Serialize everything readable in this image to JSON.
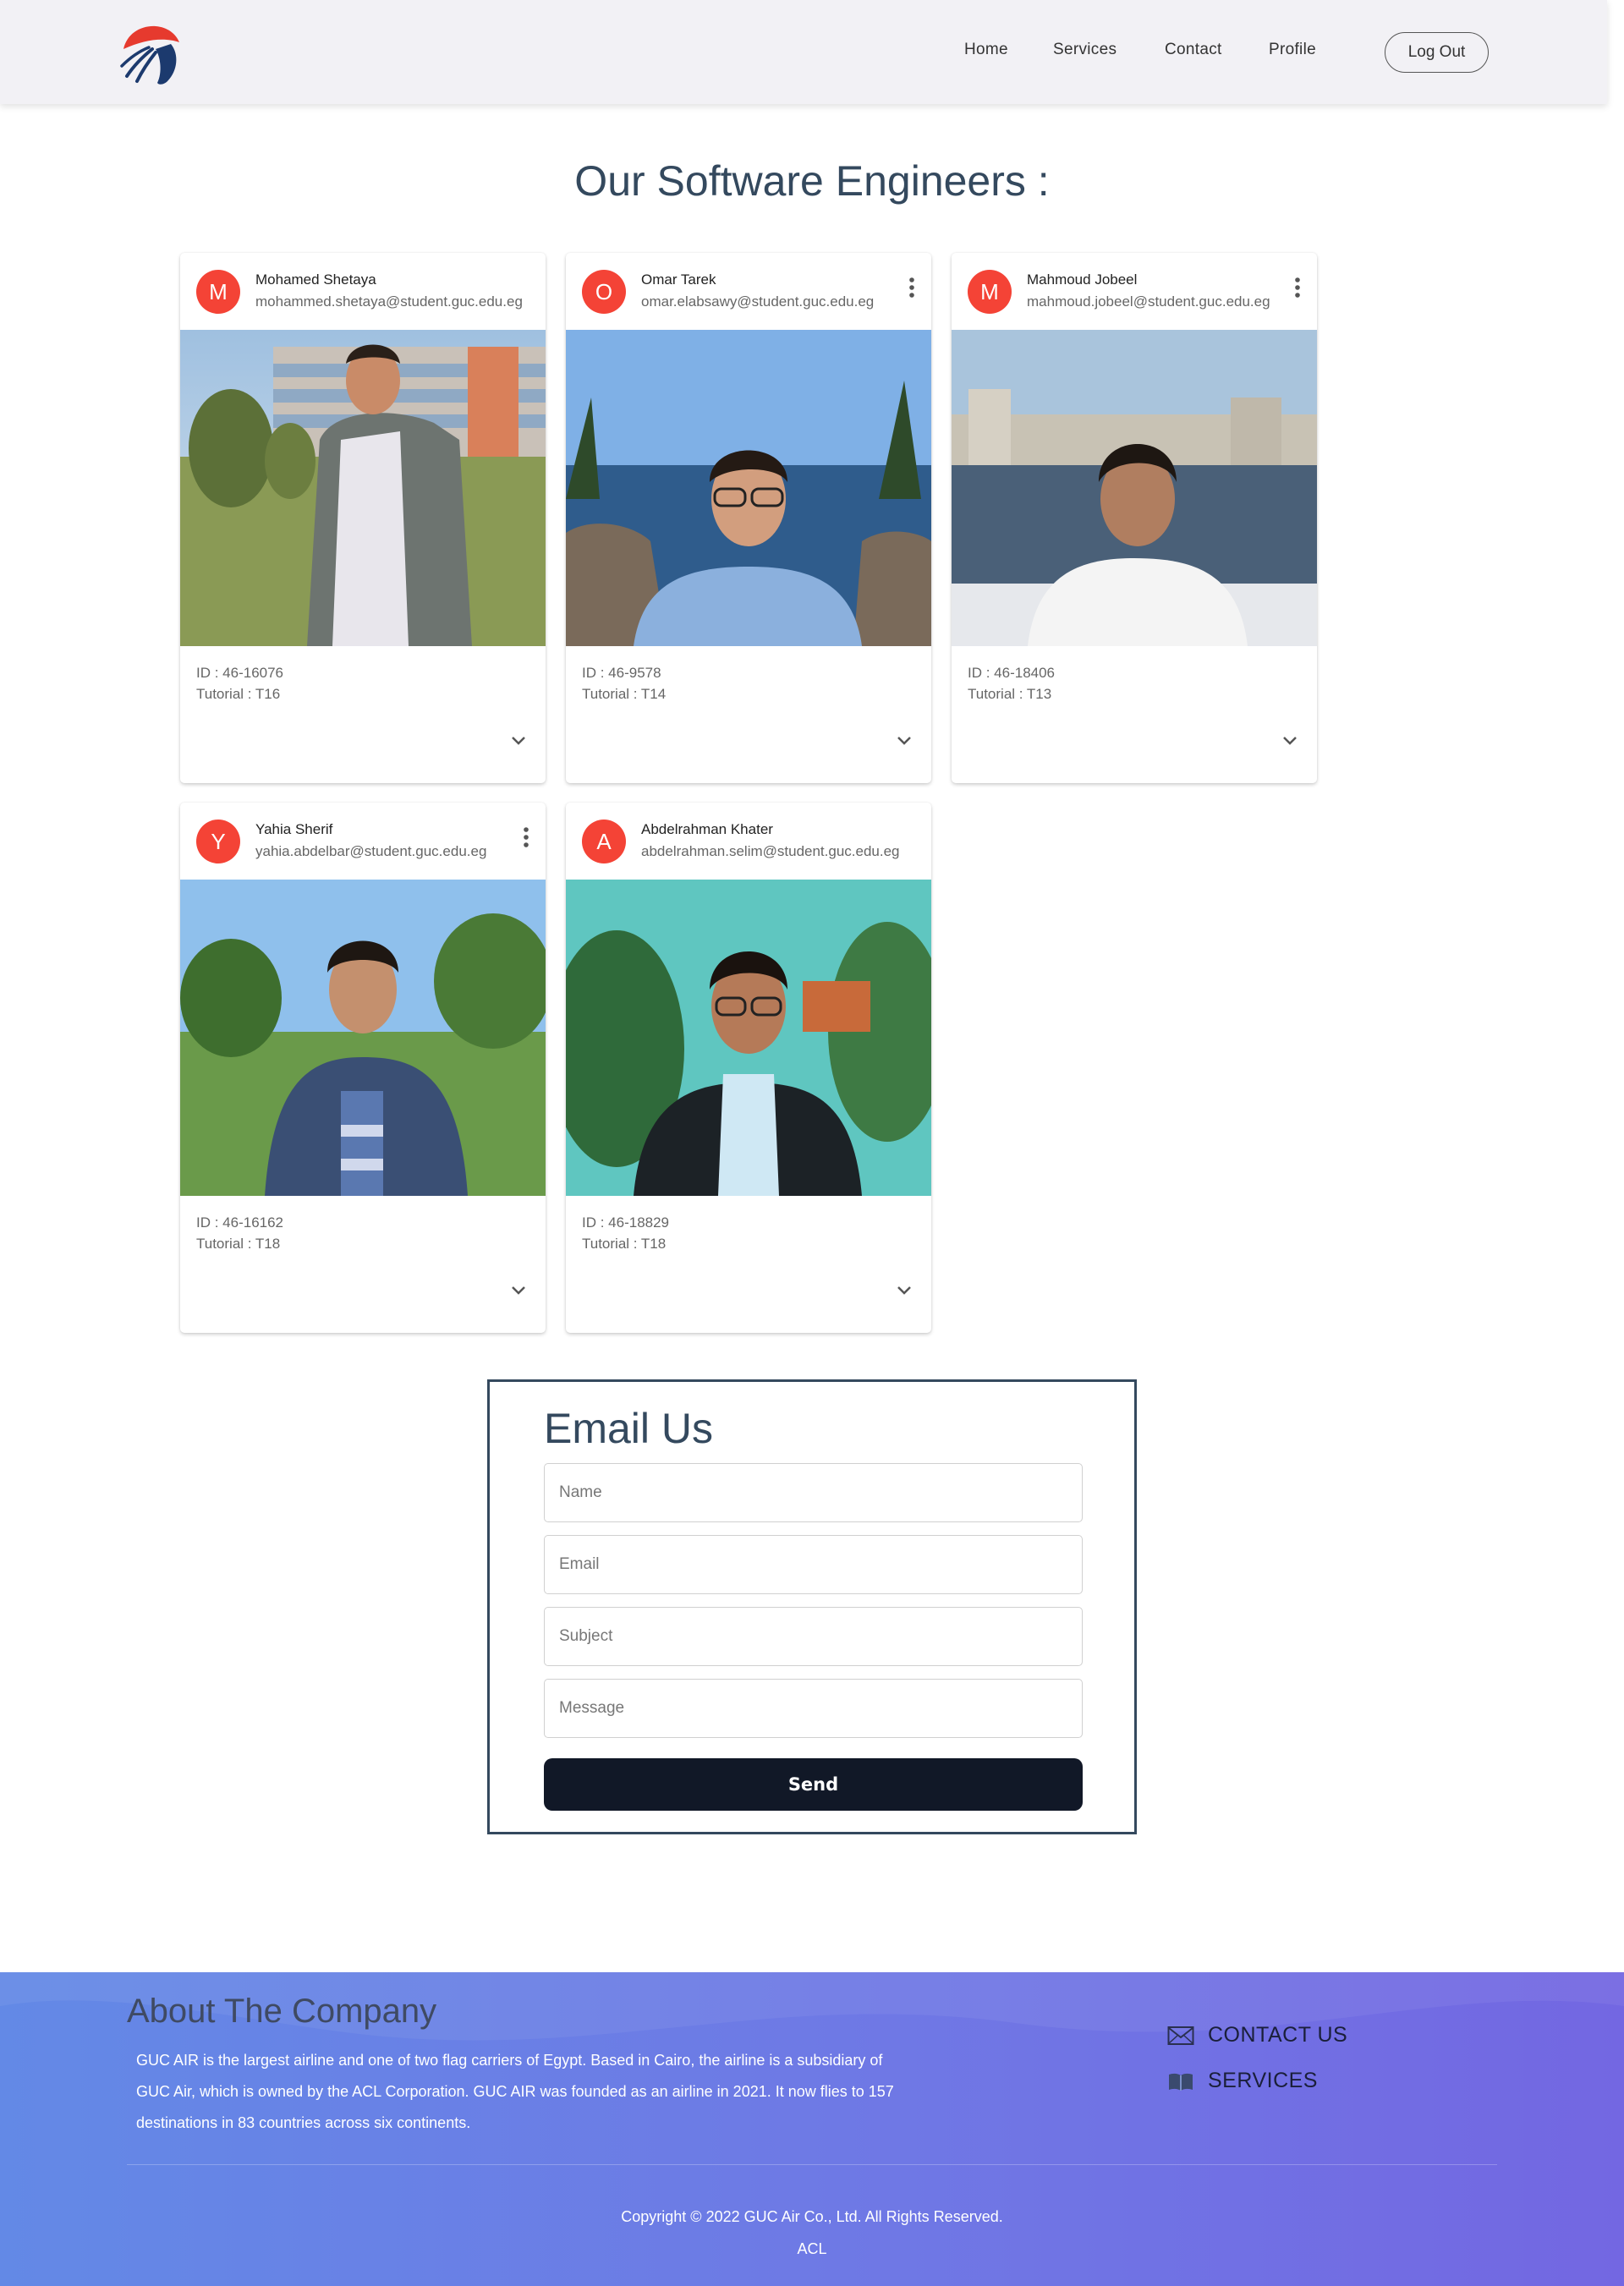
{
  "nav": {
    "links": [
      "Home",
      "Services",
      "Contact",
      "Profile"
    ],
    "logout_label": "Log Out"
  },
  "page": {
    "title": "Our Software Engineers :"
  },
  "engineers": [
    {
      "initial": "M",
      "name": "Mohamed Shetaya",
      "email": "mohammed.shetaya@student.guc.edu.eg",
      "id": "ID : 46-16076",
      "tutorial": "Tutorial : T16"
    },
    {
      "initial": "O",
      "name": "Omar Tarek",
      "email": "omar.elabsawy@student.guc.edu.eg",
      "id": "ID : 46-9578",
      "tutorial": "Tutorial : T14"
    },
    {
      "initial": "M",
      "name": "Mahmoud Jobeel",
      "email": "mahmoud.jobeel@student.guc.edu.eg",
      "id": "ID : 46-18406",
      "tutorial": "Tutorial : T13"
    },
    {
      "initial": "Y",
      "name": "Yahia Sherif",
      "email": "yahia.abdelbar@student.guc.edu.eg",
      "id": "ID : 46-16162",
      "tutorial": "Tutorial : T18"
    },
    {
      "initial": "A",
      "name": "Abdelrahman Khater",
      "email": "abdelrahman.selim@student.guc.edu.eg",
      "id": "ID : 46-18829",
      "tutorial": "Tutorial : T18"
    }
  ],
  "email_form": {
    "title": "Email Us",
    "name_placeholder": "Name",
    "email_placeholder": "Email",
    "subject_placeholder": "Subject",
    "message_placeholder": "Message",
    "send_label": "Send"
  },
  "footer": {
    "about_title": "About The Company",
    "about_text": "GUC AIR is the largest airline and one of two flag carriers of Egypt. Based in Cairo, the airline is a subsidiary of GUC Air, which is owned by the ACL Corporation. GUC AIR was founded as an airline in 2021. It now flies to 157 destinations in 83 countries across six continents.",
    "contact_label": "CONTACT US",
    "services_label": "SERVICES",
    "copyright": "Copyright © 2022 GUC Air Co., Ltd. All Rights Reserved.",
    "acl": "ACL"
  },
  "colors": {
    "accent": "#34495e",
    "avatar": "#f44336",
    "send_button": "#111827",
    "footer_start": "#6389e6",
    "footer_end": "#7367e2"
  }
}
